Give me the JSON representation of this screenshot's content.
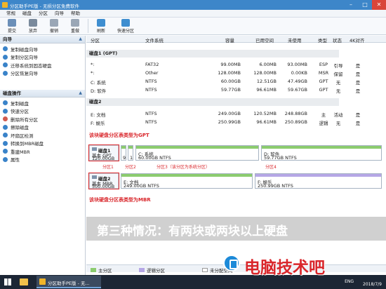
{
  "window": {
    "title": "分区助手PE版 - 无损分区免费软件"
  },
  "menu": [
    "常规",
    "磁盘",
    "分区",
    "向导",
    "帮助"
  ],
  "toolbar": [
    {
      "label": "提交",
      "icon": "check-icon"
    },
    {
      "label": "放弃",
      "icon": "discard-icon"
    },
    {
      "label": "撤销",
      "icon": "undo-icon"
    },
    {
      "label": "重做",
      "icon": "redo-icon"
    },
    {
      "label": "刷新",
      "icon": "refresh-icon"
    },
    {
      "label": "快速分区",
      "icon": "quick-partition-icon"
    }
  ],
  "sidebar": {
    "wizard_title": "向导",
    "wizard_items": [
      "复制磁盘向导",
      "复制分区向导",
      "迁移系统到固态硬盘",
      "分区恢复向导"
    ],
    "disk_ops_title": "磁盘操作",
    "disk_ops_items": [
      "复制磁盘",
      "快速分区",
      "删除所有分区",
      "擦除磁盘",
      "坏扇区检测",
      "转换到MBR磁盘",
      "重建MBR",
      "属性"
    ]
  },
  "table": {
    "headers": [
      "分区",
      "文件系统",
      "容量",
      "已用空间",
      "未使用",
      "类型",
      "状态",
      "4K对齐"
    ],
    "disk1_label": "磁盘1 (GPT)",
    "disk1_rows": [
      [
        "*:",
        "FAT32",
        "99.00MB",
        "6.00MB",
        "93.00MB",
        "ESP",
        "引导",
        "是"
      ],
      [
        "*:",
        "Other",
        "128.00MB",
        "128.00MB",
        "0.00KB",
        "MSR",
        "保留",
        "是"
      ],
      [
        "C: 系统",
        "NTFS",
        "60.00GB",
        "12.51GB",
        "47.49GB",
        "GPT",
        "无",
        "是"
      ],
      [
        "D: 软件",
        "NTFS",
        "59.77GB",
        "96.61MB",
        "59.67GB",
        "GPT",
        "无",
        "是"
      ]
    ],
    "disk2_label": "磁盘2",
    "disk2_rows": [
      [
        "E: 文档",
        "NTFS",
        "249.00GB",
        "120.52MB",
        "248.88GB",
        "主",
        "活动",
        "是"
      ],
      [
        "F: 娱乐",
        "NTFS",
        "250.99GB",
        "96.61MB",
        "250.89GB",
        "逻辑",
        "无",
        "是"
      ]
    ]
  },
  "annotations": {
    "gpt_note": "该块硬盘分区表类型为GPT",
    "mbr_note": "该块硬盘分区表类型为MBR",
    "part1": "分区1",
    "part2": "分区2",
    "part3": "分区3（该分区为系统分区）",
    "part4": "分区4"
  },
  "diskmap": {
    "disk1": {
      "name": "磁盘1",
      "kind": "基本 GPT",
      "size": "120.00GB",
      "tiny1": "9",
      "tiny2": "1",
      "c_label": "C: 系统",
      "c_size": "60.00GB NTFS",
      "d_label": "D: 软件",
      "d_size": "59.77GB NTFS"
    },
    "disk2": {
      "name": "磁盘2",
      "kind": "基本 MBR",
      "size": "500.00GB",
      "e_label": "E: 文档",
      "e_size": "249.00GB NTFS",
      "f_label": "F: 娱乐",
      "f_size": "250.99GB NTFS"
    }
  },
  "caption": "第三种情况：有两块或两块以上硬盘",
  "legend": [
    {
      "label": "主分区",
      "color": "#8ccc6f"
    },
    {
      "label": "逻辑分区",
      "color": "#b5a7e6"
    },
    {
      "label": "未分配空间",
      "color": "#ffffff"
    }
  ],
  "brand": "电脑技术吧",
  "taskbar": {
    "task_label": "分区助手PE版 - 无...",
    "lang": "ENG",
    "date": "2018/7/9"
  }
}
